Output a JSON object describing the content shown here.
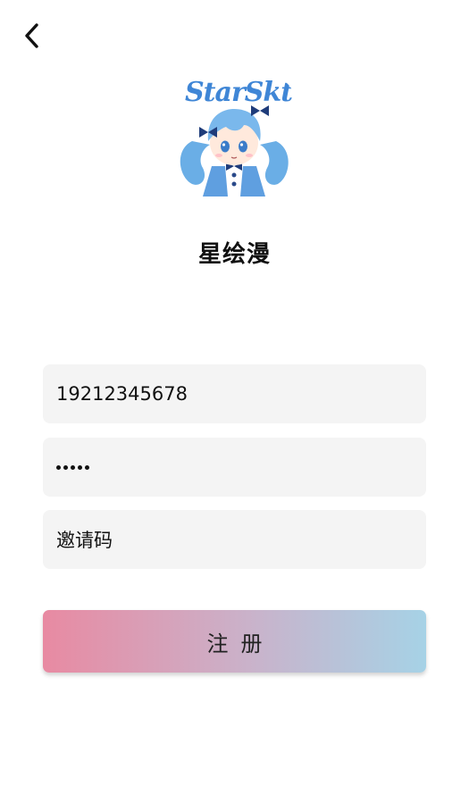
{
  "header": {
    "back_icon": "chevron-left-icon"
  },
  "logo": {
    "text": "StarSkt"
  },
  "app": {
    "name": "星绘漫"
  },
  "form": {
    "phone_value": "19212345678",
    "password_masked_length": 5,
    "invite_placeholder": "邀请码",
    "register_label": "注册"
  },
  "colors": {
    "field_background": "#f4f4f4",
    "button_gradient_start": "#e88aa2",
    "button_gradient_end": "#a6d2e6"
  }
}
